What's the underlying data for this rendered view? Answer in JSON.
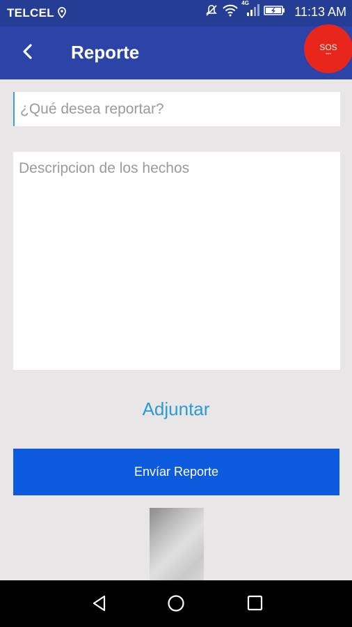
{
  "status_bar": {
    "carrier": "TELCEL",
    "network_badge": "4G",
    "time": "11:13 AM",
    "icons": [
      "location-icon",
      "mute-icon",
      "wifi-icon",
      "signal-icon",
      "battery-icon"
    ]
  },
  "app_bar": {
    "title": "Reporte",
    "sos_label": "SOS",
    "sos_sublabel": "ssm"
  },
  "form": {
    "subject_placeholder": "¿Qué desea reportar?",
    "subject_value": "",
    "description_placeholder": "Descripcion de los hechos",
    "description_value": "",
    "attach_label": "Adjuntar",
    "submit_label": "Envíar Reporte"
  },
  "colors": {
    "status_bar": "#263d96",
    "app_bar": "#2c44a7",
    "sos": "#e8261b",
    "link": "#2b9bd5",
    "button": "#0c5ade",
    "background": "#e8e6e6"
  },
  "nav_bar": {
    "icons": [
      "back-triangle-icon",
      "home-circle-icon",
      "recents-square-icon"
    ]
  }
}
